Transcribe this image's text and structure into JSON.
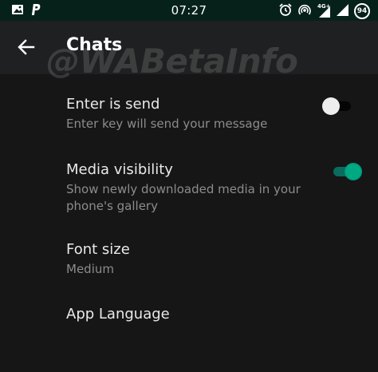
{
  "status_bar": {
    "time": "07:27",
    "left_icons": [
      "image-icon",
      "parking-icon"
    ],
    "right_icons": [
      "alarm-icon",
      "hotspot-icon",
      "signal-4g-icon",
      "signal-icon"
    ],
    "network": "4G+",
    "battery": "94"
  },
  "toolbar": {
    "title": "Chats",
    "back_icon": "arrow-left-icon"
  },
  "watermark": "@WABetaInfo",
  "settings": {
    "enter_is_send": {
      "title": "Enter is send",
      "summary": "Enter key will send your message",
      "enabled": false
    },
    "media_visibility": {
      "title": "Media visibility",
      "summary": "Show newly downloaded media in your phone's gallery",
      "enabled": true
    },
    "font_size": {
      "title": "Font size",
      "summary": "Medium"
    },
    "app_language": {
      "title": "App Language"
    }
  },
  "colors": {
    "background": "#161616",
    "toolbar": "#1f2021",
    "status_bar": "#06211a",
    "accent": "#00a884"
  }
}
